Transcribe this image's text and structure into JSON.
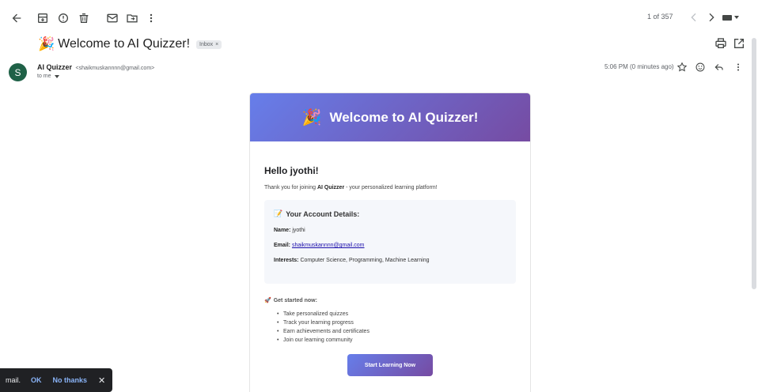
{
  "toolbar": {
    "counter": "1 of 357"
  },
  "email": {
    "subject_emoji": "🎉",
    "subject": "Welcome to AI Quizzer!",
    "label_chip": "Inbox",
    "chip_close": "×",
    "avatar_letter": "S",
    "sender_name": "AI Quizzer",
    "sender_email": "<shaikmuskannnn@gmail.com>",
    "to_me": "to me",
    "timestamp": "5:06 PM (0 minutes ago)"
  },
  "card": {
    "header_emoji": "🎉",
    "header_title": "Welcome to AI Quizzer!",
    "greeting": "Hello jyothi!",
    "thanks_prefix": "Thank you for joining ",
    "thanks_brand": "AI Quizzer",
    "thanks_suffix": " - your personalized learning platform!",
    "details_emoji": "📝",
    "details_title": "Your Account Details:",
    "name_label": "Name:",
    "name_value": "jyothi",
    "email_label": "Email:",
    "email_value": "shaikmuskannnn@gmail.com",
    "interests_label": "Interests:",
    "interests_value": "Computer Science, Programming, Machine Learning",
    "getstarted_emoji": "🚀",
    "getstarted_title": "Get started now:",
    "list": [
      "Take personalized quizzes",
      "Track your learning progress",
      "Earn achievements and certificates",
      "Join our learning community"
    ],
    "cta_label": "Start Learning Now"
  },
  "snackbar": {
    "message": "mail.",
    "ok": "OK",
    "no_thanks": "No thanks",
    "close": "✕"
  },
  "icons": {
    "back": "arrow-back-icon",
    "archive": "archive-icon",
    "report": "report-spam-icon",
    "delete": "trash-icon",
    "unread": "mark-unread-icon",
    "move": "move-to-icon",
    "more": "more-vert-icon",
    "prev": "chevron-left-icon",
    "next": "chevron-right-icon",
    "print": "print-icon",
    "open_new": "open-in-new-icon",
    "star": "star-icon",
    "emoji": "emoji-icon",
    "reply": "reply-icon"
  },
  "colors": {
    "gradient_start": "#667eea",
    "gradient_end": "#764ba2",
    "avatar": "#1f6147",
    "link": "#1a0dab",
    "snackbar_action": "#8ab4f8"
  }
}
